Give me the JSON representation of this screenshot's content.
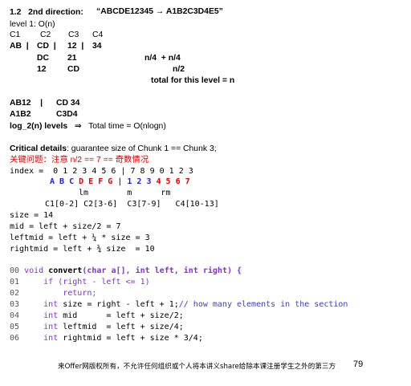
{
  "heading": {
    "number": "1.2",
    "title": "2nd direction:",
    "example": "“ABCDE12345 → A1B2C3D4E5”"
  },
  "level1": "level 1:    O(n)",
  "cols": [
    "C1",
    "C2",
    "C3",
    "C4"
  ],
  "row_ab": [
    "AB  |",
    "CD  |",
    "12  |",
    "34"
  ],
  "row_dc": [
    "DC",
    "21"
  ],
  "row_12": [
    "12",
    "CD"
  ],
  "note1": "n/4  + n/4",
  "note2": "n/2",
  "note3": "total for this level = n",
  "step2": {
    "left": "AB12    |",
    "right": "CD 34"
  },
  "step3": {
    "left": "A1B2",
    "right": "C3D4"
  },
  "levels": {
    "label": "log_2(n) levels",
    "arrow": "⇒",
    "text": "Total time = O(nlogn)"
  },
  "critical": {
    "bold": "Critical details",
    "rest": ":  guarantee size of Chunk 1 == Chunk 3;"
  },
  "cn_note": "关键问题：注意 n/2 == 7 == 奇数情况",
  "index_line": "index =  0 1 2 3 4 5 6 | 7 8 9 0 1 2 3",
  "array_letters": "A B C",
  "array_mid": "D E F G",
  "array_bar": " | ",
  "array_nums_blue": "1 2 3",
  "array_nums_red": "4 5 6 7",
  "lmr": "lm        m      rm",
  "chunks": "C1[0-2] C2[3-6]  C3[7-9]   C4[10-13]",
  "size_line": "size = 14",
  "mid_line": "mid = left + size/2 = 7",
  "leftmid_line": "leftmid = left + ¼ * size = 3",
  "rightmid_line": "rightmid = left + ¾ size  = 10",
  "code": {
    "l00": {
      "num": "00",
      "pre": "void ",
      "fn": "convert",
      "args": "(char a[], int left, int right) {"
    },
    "l01": {
      "num": "01",
      "text": "if (right - left <= 1)"
    },
    "l02": {
      "num": "02",
      "text": "return;"
    },
    "l03": {
      "num": "03",
      "kw": "int",
      "text": " size = right - left + 1;",
      "comment": "// how many elements in the section"
    },
    "l04": {
      "num": "04",
      "kw": "int",
      "text": " mid      = left + size/2;"
    },
    "l05": {
      "num": "05",
      "kw": "int",
      "text": " leftmid  = left + size/4;"
    },
    "l06": {
      "num": "06",
      "kw": "int",
      "text": " rightmid = left + size * 3/4;"
    }
  },
  "footer": {
    "text": "来Offer网版权所有，不允许任何组织或个人将本讲义share给除本课注册学生之外的第三方",
    "page": "79"
  }
}
